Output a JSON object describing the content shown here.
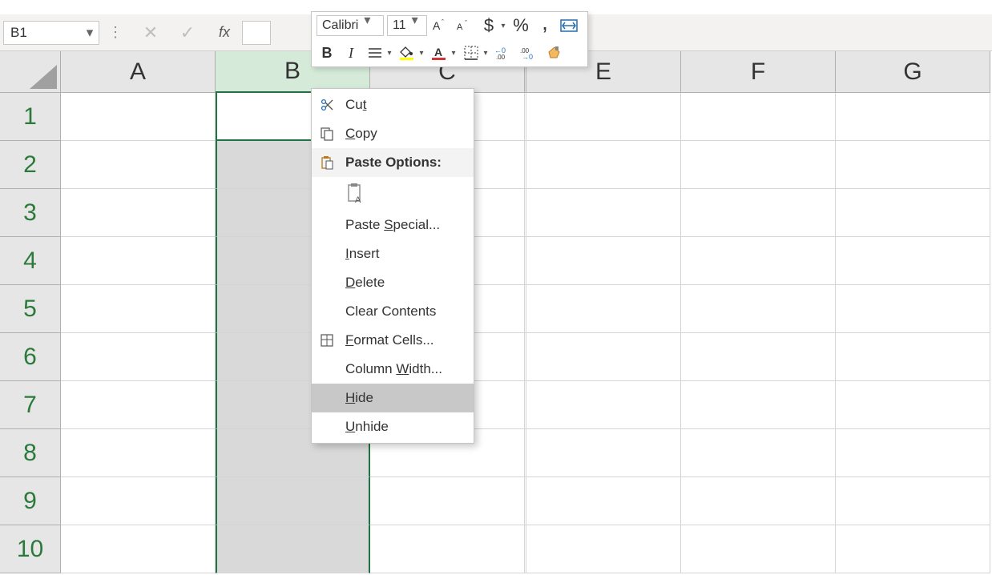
{
  "namebox": {
    "value": "B1"
  },
  "mini_toolbar": {
    "font": "Calibri",
    "size": "11",
    "bold_label": "B",
    "italic_label": "I",
    "currency": "$",
    "percent": "%",
    "comma": ","
  },
  "columns": [
    "A",
    "B",
    "C",
    "-",
    "E",
    "F",
    "G"
  ],
  "rows": [
    "1",
    "2",
    "3",
    "4",
    "5",
    "6",
    "7",
    "8",
    "9",
    "10"
  ],
  "context_menu": {
    "cut": "Cut",
    "copy": "Copy",
    "paste_options": "Paste Options:",
    "paste_special": "Paste Special...",
    "insert": "Insert",
    "delete": "Delete",
    "clear": "Clear Contents",
    "format_cells": "Format Cells...",
    "column_width": "Column Width...",
    "hide": "Hide",
    "unhide": "Unhide"
  }
}
